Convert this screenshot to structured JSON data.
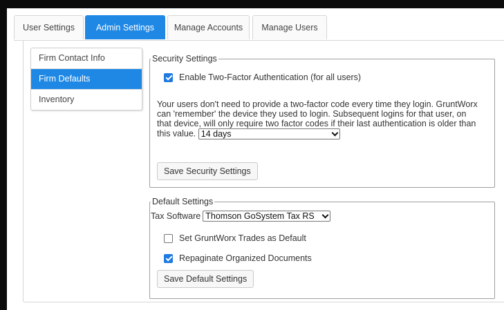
{
  "tabs": [
    {
      "label": "User Settings",
      "active": false
    },
    {
      "label": "Admin Settings",
      "active": true
    },
    {
      "label": "Manage Accounts",
      "active": false
    },
    {
      "label": "Manage Users",
      "active": false
    }
  ],
  "sidebar": {
    "items": [
      {
        "label": "Firm Contact Info",
        "active": false
      },
      {
        "label": "Firm Defaults",
        "active": true
      },
      {
        "label": "Inventory",
        "active": false
      }
    ]
  },
  "security": {
    "legend": "Security Settings",
    "two_factor": {
      "label": "Enable Two-Factor Authentication (for all users)",
      "checked": true
    },
    "description": "Your users don't need to provide a two-factor code every time they login. GruntWorx can 'remember' the device they used to login. Subsequent logins for that user, on that device, will only require two factor codes if their last authentication is older than this value.",
    "remember_select": {
      "value": "14 days"
    },
    "save_label": "Save Security Settings"
  },
  "defaults": {
    "legend": "Default Settings",
    "tax_software_label": "Tax Software",
    "tax_software_select": {
      "value": "Thomson GoSystem Tax RS"
    },
    "trades_default": {
      "label": "Set GruntWorx Trades as Default",
      "checked": false
    },
    "repaginate": {
      "label": "Repaginate Organized Documents",
      "checked": true
    },
    "save_label": "Save Default Settings"
  },
  "colors": {
    "accent": "#1f88e5",
    "page_bg": "#0b0b0b"
  }
}
